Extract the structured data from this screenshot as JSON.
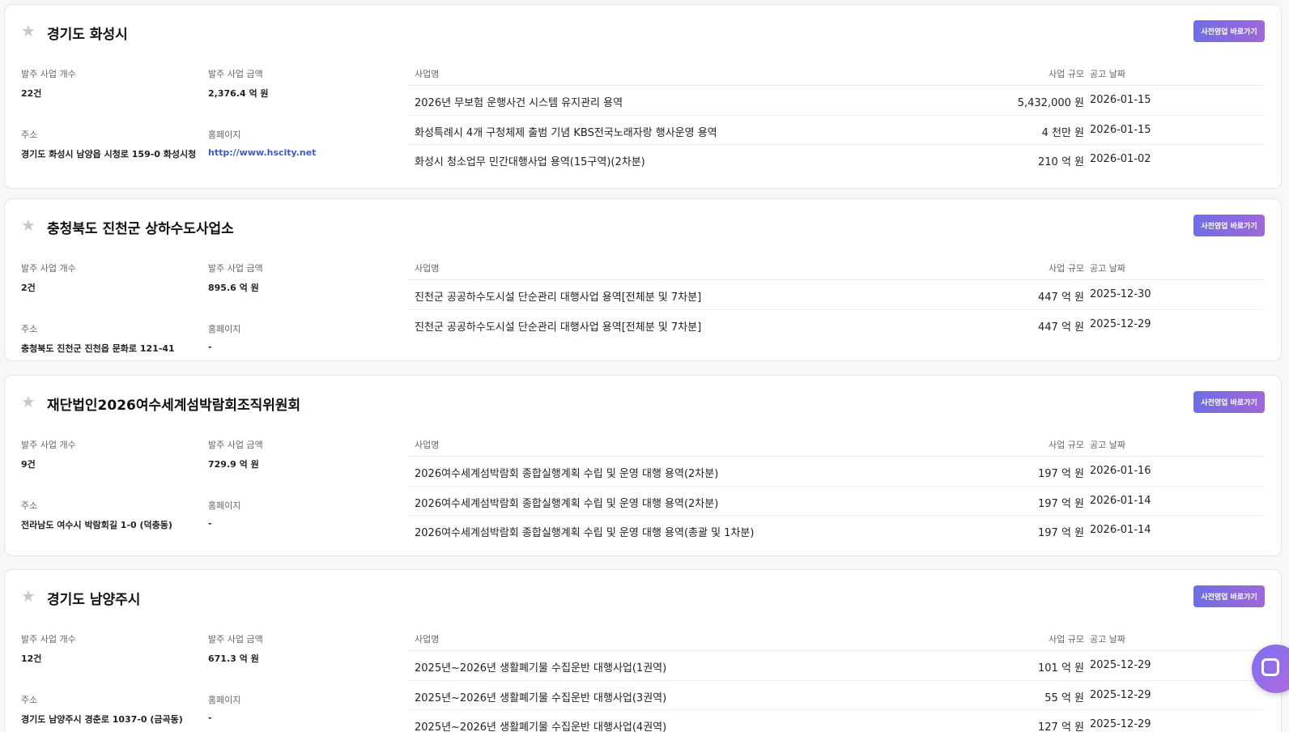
{
  "labels": {
    "bid_count": "발주 사업 개수",
    "bid_amount": "발주 사업 금액",
    "address": "주소",
    "homepage": "홈페이지",
    "col_name": "사업명",
    "col_amount": "사업 규모",
    "col_date": "공고 날짜",
    "presale_button": "사전영업 바로가기"
  },
  "orgs": [
    {
      "name": "경기도 화성시",
      "bid_count": "22건",
      "bid_amount": "2,376.4 억 원",
      "address": "경기도 화성시 남양읍 시청로 159-0 화성시청",
      "homepage": "http://www.hscity.net",
      "bids": [
        {
          "name": "2026년 무보험 운행사건 시스템 유지관리 용역",
          "amount": "5,432,000 원",
          "date": "2026-01-15"
        },
        {
          "name": "화성특례시 4개 구청체제 출범 기념 KBS전국노래자랑 행사운영 용역",
          "amount": "4 천만 원",
          "date": "2026-01-15"
        },
        {
          "name": "화성시 청소업무 민간대행사업 용역(15구역)(2차분)",
          "amount": "210 억 원",
          "date": "2026-01-02"
        }
      ]
    },
    {
      "name": "충청북도 진천군 상하수도사업소",
      "bid_count": "2건",
      "bid_amount": "895.6 억 원",
      "address": "충청북도 진천군 진천읍 문화로 121-41",
      "homepage": "-",
      "bids": [
        {
          "name": "진천군 공공하수도시설 단순관리 대행사업 용역[전체분 및 7차분]",
          "amount": "447 억 원",
          "date": "2025-12-30"
        },
        {
          "name": "진천군 공공하수도시설 단순관리 대행사업 용역[전체분 및 7차분]",
          "amount": "447 억 원",
          "date": "2025-12-29"
        }
      ]
    },
    {
      "name": "재단법인2026여수세계섬박람회조직위원회",
      "bid_count": "9건",
      "bid_amount": "729.9 억 원",
      "address": "전라남도 여수시 박람회길 1-0 (덕충동)",
      "homepage": "-",
      "bids": [
        {
          "name": "2026여수세계섬박람회 종합실행계획 수립 및 운영 대행 용역(2차분)",
          "amount": "197 억 원",
          "date": "2026-01-16"
        },
        {
          "name": "2026여수세계섬박람회 종합실행계획 수립 및 운영 대행 용역(2차분)",
          "amount": "197 억 원",
          "date": "2026-01-14"
        },
        {
          "name": "2026여수세계섬박람회 종합실행계획 수립 및 운영 대행 용역(총괄 및 1차분)",
          "amount": "197 억 원",
          "date": "2026-01-14"
        }
      ]
    },
    {
      "name": "경기도 남양주시",
      "bid_count": "12건",
      "bid_amount": "671.3 억 원",
      "address": "경기도 남양주시 경춘로 1037-0 (금곡동)",
      "homepage": "-",
      "bids": [
        {
          "name": "2025년~2026년 생활폐기물 수집운반 대행사업(1권역)",
          "amount": "101 억 원",
          "date": "2025-12-29"
        },
        {
          "name": "2025년~2026년 생활폐기물 수집운반 대행사업(3권역)",
          "amount": "55 억 원",
          "date": "2025-12-29"
        },
        {
          "name": "2025년~2026년 생활폐기물 수집운반 대행사업(4권역)",
          "amount": "127 억 원",
          "date": "2025-12-29"
        }
      ]
    }
  ]
}
